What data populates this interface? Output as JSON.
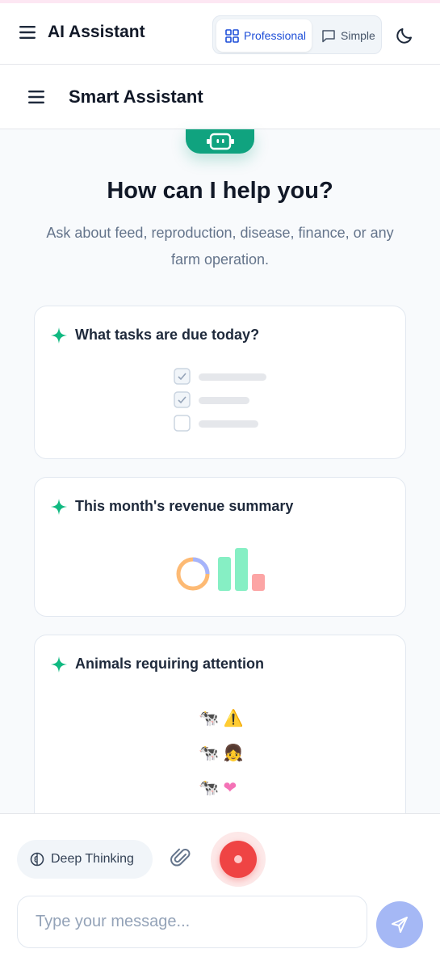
{
  "app": {
    "title": "AI Assistant",
    "modes": [
      {
        "label": "Professional",
        "active": true
      },
      {
        "label": "Simple",
        "active": false
      }
    ]
  },
  "subheader": {
    "title": "Smart Assistant"
  },
  "welcome": {
    "heading": "How can I help you?",
    "subtitle": "Ask about feed, reproduction, disease, finance, or any farm operation."
  },
  "suggestions": [
    {
      "label": "What tasks are due today?",
      "illustration": "checklist-icon"
    },
    {
      "label": "This month's revenue summary",
      "illustration": "chart-icon"
    },
    {
      "label": "Animals requiring attention",
      "illustration": "cow-icon",
      "emoji": [
        "🐄",
        "⚠️",
        "🐄",
        "👧",
        "🐄",
        "❤"
      ]
    }
  ],
  "composer": {
    "deep_thinking_label": "Deep Thinking",
    "placeholder": "Type your message..."
  },
  "colors": {
    "brand_green": "#10a37f",
    "accent_blue": "#1d4ed8",
    "record_red": "#ef4444",
    "send_blue": "#a5b8f5"
  }
}
